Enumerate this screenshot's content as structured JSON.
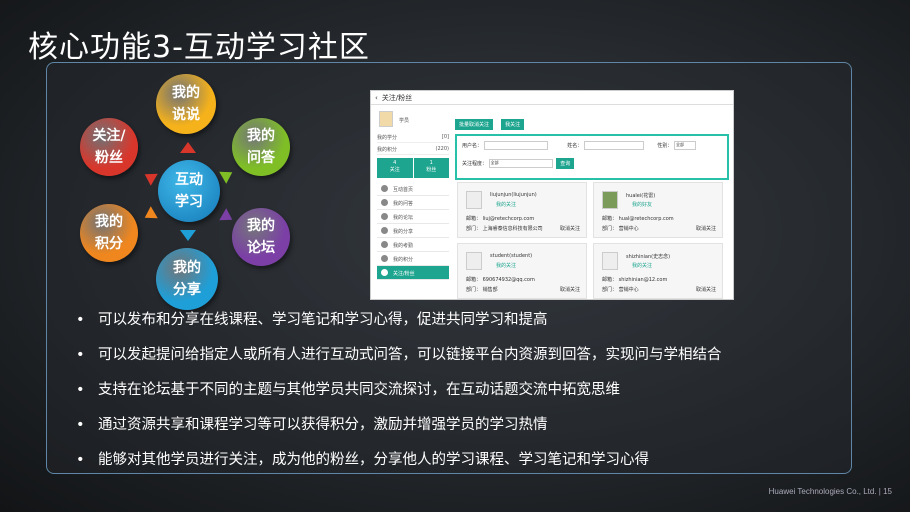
{
  "title": "核心功能3-互动学习社区",
  "diagram": {
    "center": "互动\n学习",
    "nodes": [
      {
        "label": "我的\n说说",
        "color": "#f6b21a"
      },
      {
        "label": "我的\n问答",
        "color": "#7fbf25"
      },
      {
        "label": "我的\n论坛",
        "color": "#7b3fa6"
      },
      {
        "label": "我的\n分享",
        "color": "#1e9fd8"
      },
      {
        "label": "我的\n积分",
        "color": "#f0871e"
      },
      {
        "label": "关注/\n粉丝",
        "color": "#d9362b"
      }
    ]
  },
  "screenshot": {
    "back_icon": "chevron-left-icon",
    "header": "关注/粉丝",
    "user": {
      "name": "学员",
      "score_label": "我的学分",
      "score_value": "[0]",
      "points_label": "我的积分",
      "points_value": "(220)"
    },
    "follow_box": {
      "follow_count": "4",
      "follow_label": "关注",
      "fan_count": "1",
      "fan_label": "粉丝"
    },
    "menu": [
      "互动首页",
      "我的问答",
      "我的论坛",
      "我的分享",
      "我的考勤",
      "我的积分",
      "关注/粉丝"
    ],
    "buttons": [
      "批量取消关注",
      "我关注"
    ],
    "search": {
      "user_label": "用户名：",
      "name_label": "姓名：",
      "gender_label": "性别：",
      "gender_value": "全部",
      "level_label": "关注程度：",
      "level_value": "全部",
      "search_btn": "查询"
    },
    "cards": [
      {
        "name": "liujunjun(liujunjun)",
        "sub": "我的关注",
        "email": "邮箱： liuj@retechcorp.com",
        "dept": "部门： 上海睿泰信息科技有限公司",
        "action": "取消关注"
      },
      {
        "name": "hualei(花雷)",
        "sub": "我的好友",
        "email": "邮箱： hual@retechcorp.com",
        "dept": "部门： 营销中心",
        "action": "取消关注"
      },
      {
        "name": "student(student)",
        "sub": "我的关注",
        "email": "邮箱： 690674932@qq.com",
        "dept": "部门： 销售部",
        "action": "取消关注"
      },
      {
        "name": "shizhinian(史志念)",
        "sub": "我的关注",
        "email": "邮箱： shizhinian@12.com",
        "dept": "部门： 营销中心",
        "action": "取消关注"
      }
    ]
  },
  "bullets": [
    "可以发布和分享在线课程、学习笔记和学习心得，促进共同学习和提高",
    "可以发起提问给指定人或所有人进行互动式问答，可以链接平台内资源到回答，实现问与学相结合",
    "支持在论坛基于不同的主题与其他学员共同交流探讨，在互动话题交流中拓宽思维",
    "通过资源共享和课程学习等可以获得积分，激励并增强学员的学习热情",
    "能够对其他学员进行关注，成为他的粉丝，分享他人的学习课程、学习笔记和学习心得"
  ],
  "bullet_symbol": "•",
  "footer": "Huawei Technologies Co., Ltd.  |   15"
}
